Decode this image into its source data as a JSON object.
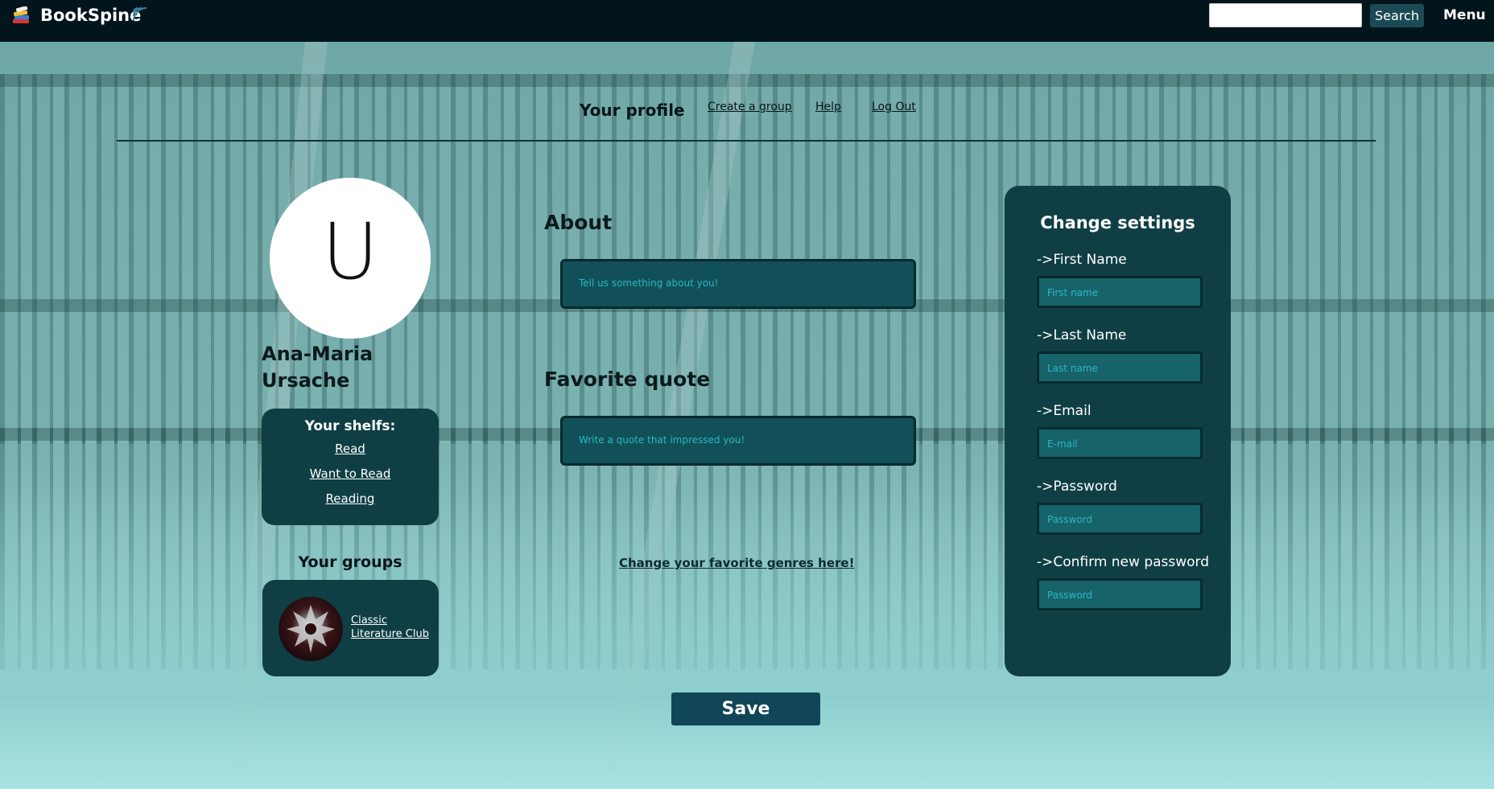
{
  "header": {
    "brand": "BookSpine",
    "search_button": "Search",
    "menu": "Menu",
    "search_value": ""
  },
  "nav": {
    "profile": "Your profile",
    "create_group": "Create a group",
    "help": "Help",
    "logout": "Log Out"
  },
  "profile": {
    "avatar_letter": "U",
    "name": "Ana-Maria Ursache"
  },
  "shelves": {
    "title": "Your shelfs:",
    "items": [
      "Read",
      "Want to Read",
      "Reading"
    ]
  },
  "groups": {
    "title": "Your groups",
    "items": [
      {
        "name": "Classic Literature Club"
      }
    ]
  },
  "about": {
    "heading": "About",
    "placeholder": "Tell us something about you!"
  },
  "quote": {
    "heading": "Favorite quote",
    "placeholder": "Write a quote that impressed you!"
  },
  "genres_link": "Change your favorite genres here!",
  "save_button": "Save",
  "settings": {
    "title": "Change settings",
    "fields": [
      {
        "label": "->First Name",
        "placeholder": "First name"
      },
      {
        "label": "->Last Name",
        "placeholder": "Last name"
      },
      {
        "label": "->Email",
        "placeholder": "E-mail"
      },
      {
        "label": "->Password",
        "placeholder": "Password"
      },
      {
        "label": "->Confirm new password",
        "placeholder": "Password"
      }
    ]
  },
  "colors": {
    "topbar": "#02141c",
    "panel": "#0f3f45",
    "field": "#115058",
    "placeholder_text": "#2bb7c3",
    "save_button": "#114558"
  }
}
